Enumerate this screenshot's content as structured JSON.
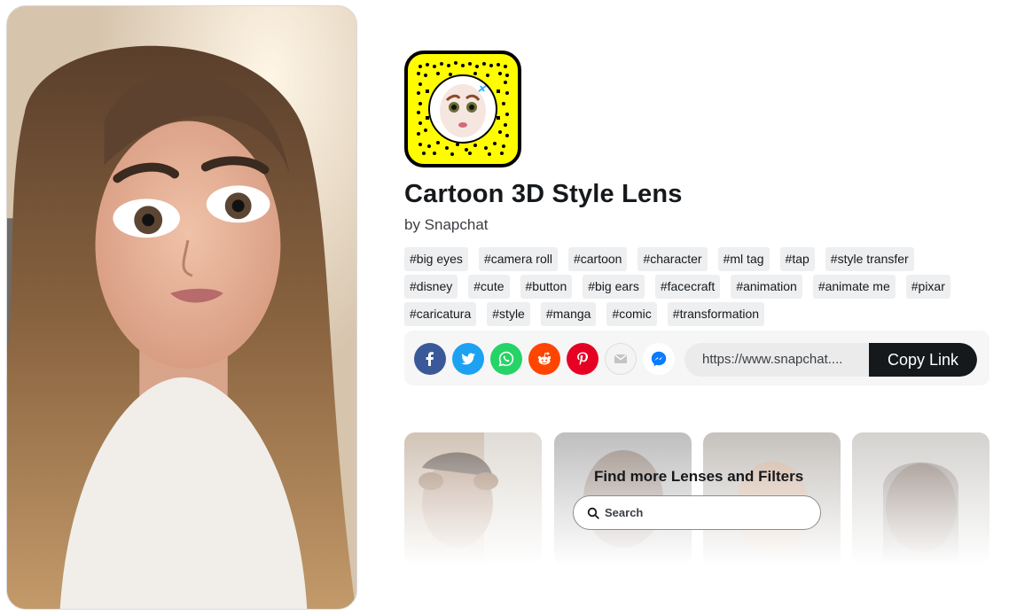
{
  "lens": {
    "title": "Cartoon 3D Style Lens",
    "byline": "by Snapchat"
  },
  "tags": [
    "#big eyes",
    "#camera roll",
    "#cartoon",
    "#character",
    "#ml tag",
    "#tap",
    "#style transfer",
    "#disney",
    "#cute",
    "#button",
    "#big ears",
    "#facecraft",
    "#animation",
    "#animate me",
    "#pixar",
    "#caricatura",
    "#style",
    "#manga",
    "#comic",
    "#transformation"
  ],
  "share": {
    "icons": [
      {
        "name": "facebook-icon",
        "color": "#3b5998"
      },
      {
        "name": "twitter-icon",
        "color": "#1da1f2"
      },
      {
        "name": "whatsapp-icon",
        "color": "#25d366"
      },
      {
        "name": "reddit-icon",
        "color": "#ff4500"
      },
      {
        "name": "pinterest-icon",
        "color": "#e60023"
      },
      {
        "name": "email-icon",
        "color": "#f4f4f4"
      },
      {
        "name": "messenger-icon",
        "color": "#ffffff"
      }
    ],
    "url": "https://www.snapchat....",
    "copy_label": "Copy Link"
  },
  "more": {
    "title": "Find more Lenses and Filters",
    "search_placeholder": "Search"
  },
  "colors": {
    "snap_yellow": "#fffc00",
    "copy_button": "#16191c",
    "tag_bg": "#eeeff0"
  }
}
